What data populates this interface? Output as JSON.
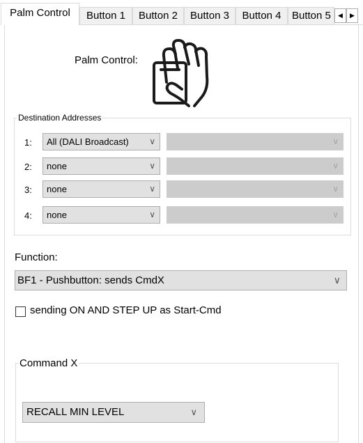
{
  "tabs": [
    {
      "label": "Palm Control",
      "active": true
    },
    {
      "label": "Button 1"
    },
    {
      "label": "Button 2"
    },
    {
      "label": "Button 3"
    },
    {
      "label": "Button 4"
    },
    {
      "label": "Button 5"
    }
  ],
  "scroll": {
    "left_icon": "scroll-left-arrow-icon",
    "right_icon": "scroll-right-arrow-icon"
  },
  "palm": {
    "label": "Palm Control:",
    "icon": "palm-hand-icon"
  },
  "destinations": {
    "legend": "Destination Addresses",
    "rows": [
      {
        "index": "1:",
        "value": "All (DALI Broadcast)"
      },
      {
        "index": "2:",
        "value": "none"
      },
      {
        "index": "3:",
        "value": "none"
      },
      {
        "index": "4:",
        "value": "none"
      }
    ]
  },
  "function": {
    "label": "Function:",
    "value": "BF1 - Pushbutton:  sends CmdX"
  },
  "checkbox": {
    "label": "sending ON AND STEP UP as Start-Cmd",
    "checked": false
  },
  "command_x": {
    "legend": "Command X",
    "value": "RECALL MIN LEVEL"
  }
}
